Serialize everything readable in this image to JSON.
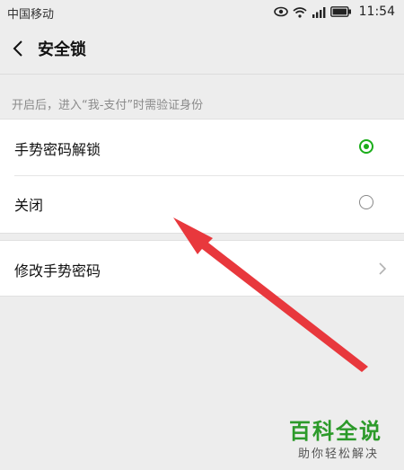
{
  "status_bar": {
    "carrier": "中国移动",
    "time": "11:54",
    "icons": [
      "eye-icon",
      "wifi-icon",
      "signal-icon",
      "battery-icon"
    ]
  },
  "nav": {
    "title": "安全锁",
    "back_icon": "chevron-left-icon"
  },
  "hint": "开启后，进入“我-支付”时需验证身份",
  "options": [
    {
      "label": "手势密码解锁",
      "selected": true
    },
    {
      "label": "关闭",
      "selected": false
    }
  ],
  "settings": {
    "change_password_label": "修改手势密码"
  },
  "watermark": {
    "title": "百科全说",
    "subtitle": "助你轻松解决"
  },
  "colors": {
    "accent": "#1aad19",
    "annotation_arrow": "#e8383d"
  }
}
